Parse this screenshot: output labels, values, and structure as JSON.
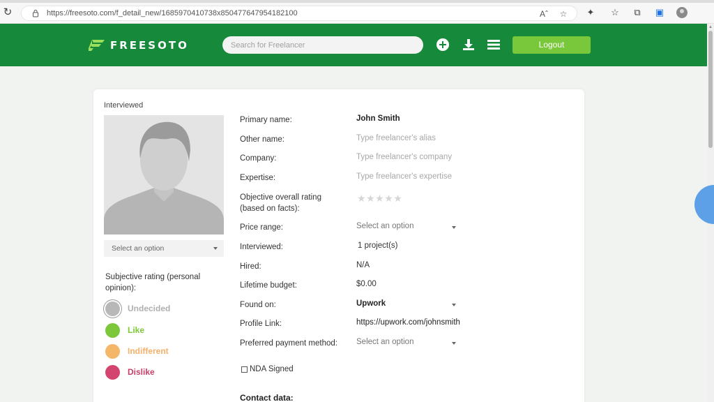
{
  "browser": {
    "url": "https://freesoto.com/f_detail_new/1685970410738x850477647954182100"
  },
  "header": {
    "logo_text": "FREESOTO",
    "search_placeholder": "Search for Freelancer",
    "logout_label": "Logout"
  },
  "profile": {
    "status": "Interviewed",
    "photo_select_placeholder": "Select an option",
    "subjective_label": "Subjective rating (personal opinion):",
    "ratings": [
      {
        "label": "Undecided",
        "color": "#b8b8b8",
        "text_color": "#b0b0b0"
      },
      {
        "label": "Like",
        "color": "#7cc83a",
        "text_color": "#7cc83a"
      },
      {
        "label": "Indifferent",
        "color": "#f4b76a",
        "text_color": "#f4b06a"
      },
      {
        "label": "Dislike",
        "color": "#d3456f",
        "text_color": "#c8406a"
      }
    ],
    "fields": {
      "primary_name_label": "Primary name:",
      "primary_name_value": "John Smith",
      "other_name_label": "Other name:",
      "other_name_placeholder": "Type freelancer's alias",
      "company_label": "Company:",
      "company_placeholder": "Type freelancer's company",
      "expertise_label": "Expertise:",
      "expertise_placeholder": "Type freelancer's expertise",
      "objective_rating_label": "Objective overall rating (based on facts):",
      "objective_rating_value": 0,
      "objective_rating_max": 5,
      "price_range_label": "Price range:",
      "price_range_placeholder": "Select an option",
      "interviewed_label": "Interviewed:",
      "interviewed_value": "1 project(s)",
      "hired_label": "Hired:",
      "hired_value": "N/A",
      "lifetime_budget_label": "Lifetime budget:",
      "lifetime_budget_value": "$0.00",
      "found_on_label": "Found on:",
      "found_on_value": "Upwork",
      "profile_link_label": "Profile Link:",
      "profile_link_value": "https://upwork.com/johnsmith",
      "payment_method_label": "Preferred payment method:",
      "payment_method_placeholder": "Select an option",
      "nda_label": "NDA Signed",
      "nda_checked": false,
      "contact_heading": "Contact data:"
    }
  },
  "colors": {
    "header_green": "#16893a",
    "logout_green": "#79c73a",
    "page_bg": "#f1f3f1"
  }
}
